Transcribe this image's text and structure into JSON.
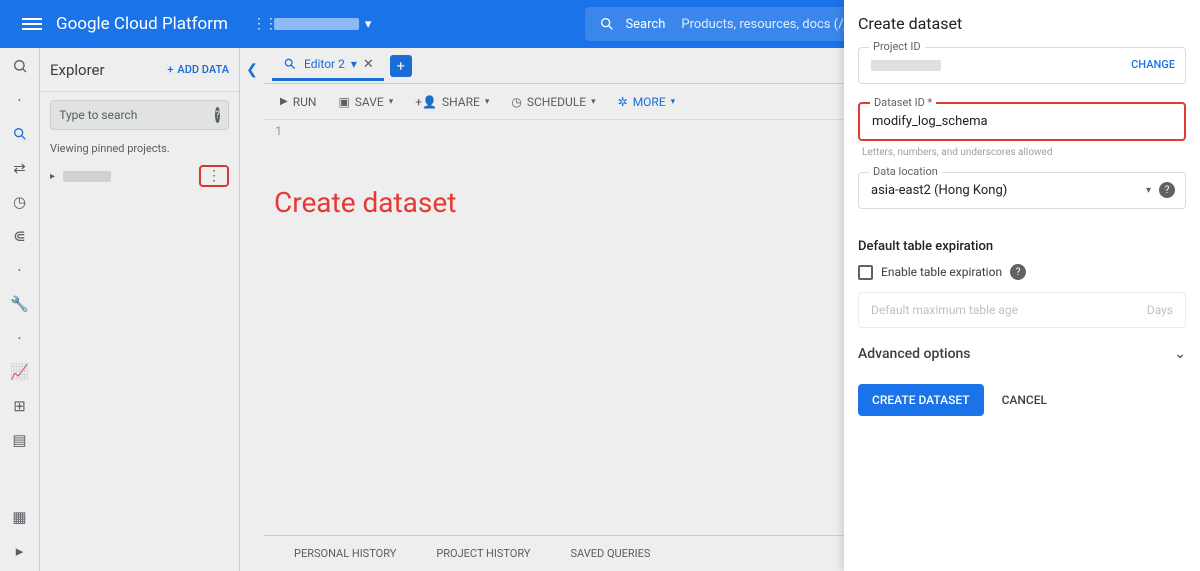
{
  "header": {
    "brand": "Google Cloud Platform",
    "search_label": "Search",
    "search_placeholder": "Products, resources, docs (/)"
  },
  "explorer": {
    "title": "Explorer",
    "add_data": "ADD DATA",
    "search_placeholder": "Type to search",
    "viewing": "Viewing pinned projects."
  },
  "editor": {
    "tab_label": "Editor 2",
    "run": "RUN",
    "save": "SAVE",
    "share": "SHARE",
    "schedule": "SCHEDULE",
    "more": "MORE",
    "line_no": "1"
  },
  "annotation": "Create dataset",
  "bottom": {
    "personal": "PERSONAL HISTORY",
    "project": "PROJECT HISTORY",
    "saved": "SAVED QUERIES"
  },
  "panel": {
    "title": "Create dataset",
    "project_id_label": "Project ID",
    "change": "CHANGE",
    "dataset_id_label": "Dataset ID *",
    "dataset_id_value": "modify_log_schema",
    "dataset_id_help": "Letters, numbers, and underscores allowed",
    "location_label": "Data location",
    "location_value": "asia-east2 (Hong Kong)",
    "expiration_title": "Default table expiration",
    "enable_exp": "Enable table expiration",
    "max_age_placeholder": "Default maximum table age",
    "days": "Days",
    "advanced": "Advanced options",
    "create": "CREATE DATASET",
    "cancel": "CANCEL"
  },
  "icons": {
    "search": "search",
    "chevron_down": "▾",
    "close": "✕",
    "plus": "+",
    "play": "▶",
    "more_vert": "⋮",
    "arrow_right": "▸",
    "collapse": "❮",
    "expand": "❯"
  }
}
